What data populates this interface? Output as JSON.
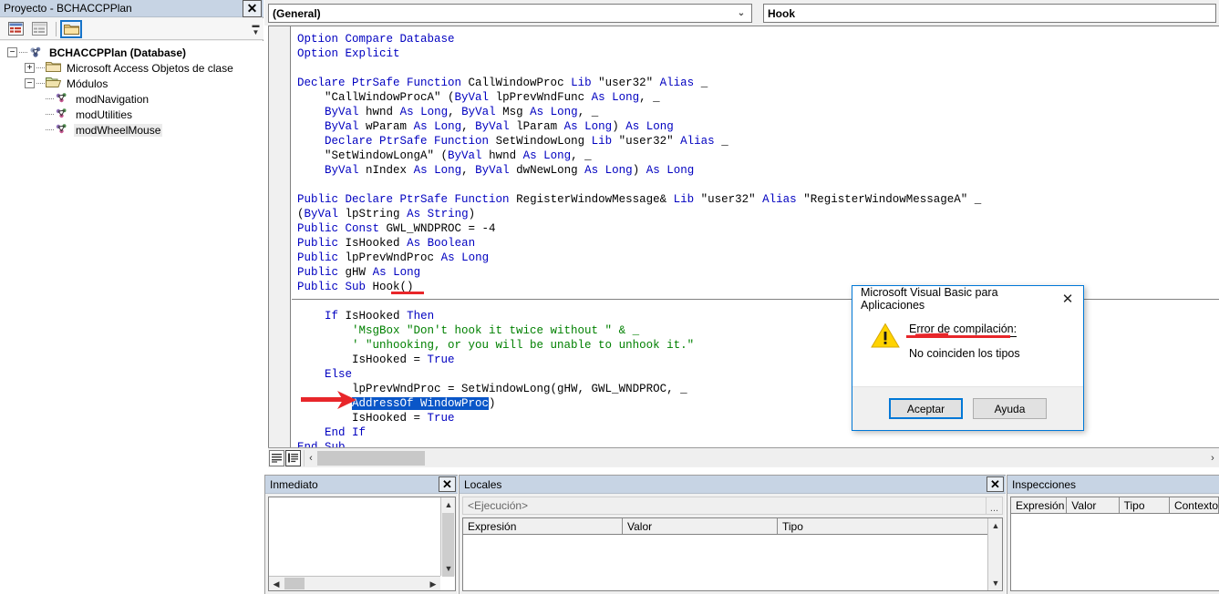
{
  "project_explorer": {
    "title": "Proyecto - BCHACCPPlan",
    "close_label": "✕",
    "toolbar": [
      {
        "name": "view-code-button",
        "label": ""
      },
      {
        "name": "view-object-button",
        "label": ""
      },
      {
        "name": "toggle-folders-button",
        "label": ""
      }
    ],
    "tree": [
      {
        "label": "BCHACCPPlan (Database)",
        "icon": "database-icon",
        "depth": 0,
        "expander": "−",
        "bold": true,
        "selected": false
      },
      {
        "label": "Microsoft Access Objetos de clase",
        "icon": "folder-icon",
        "depth": 1,
        "expander": "+",
        "bold": false,
        "selected": false
      },
      {
        "label": "Módulos",
        "icon": "folder-open-icon",
        "depth": 1,
        "expander": "−",
        "bold": false,
        "selected": false
      },
      {
        "label": "modNavigation",
        "icon": "module-icon",
        "depth": 2,
        "expander": "",
        "bold": false,
        "selected": false
      },
      {
        "label": "modUtilities",
        "icon": "module-icon",
        "depth": 2,
        "expander": "",
        "bold": false,
        "selected": false
      },
      {
        "label": "modWheelMouse",
        "icon": "module-icon",
        "depth": 2,
        "expander": "",
        "bold": false,
        "selected": true
      }
    ]
  },
  "code_editor": {
    "object_combo": {
      "value": "(General)",
      "chevron": "⌄"
    },
    "proc_combo": {
      "value": "Hook",
      "chevron": ""
    },
    "horizontal_scroll": {
      "left_arrow": "‹",
      "right_arrow": "›"
    },
    "lines": [
      {
        "text": "Option Compare Database"
      },
      {
        "text": "Option Explicit"
      },
      {
        "text": ""
      },
      {
        "text": "Declare PtrSafe Function CallWindowProc Lib \"user32\" Alias _"
      },
      {
        "text": "    \"CallWindowProcA\" (ByVal lpPrevWndFunc As Long, _"
      },
      {
        "text": "    ByVal hwnd As Long, ByVal Msg As Long, _"
      },
      {
        "text": "    ByVal wParam As Long, ByVal lParam As Long) As Long"
      },
      {
        "text": "    Declare PtrSafe Function SetWindowLong Lib \"user32\" Alias _"
      },
      {
        "text": "    \"SetWindowLongA\" (ByVal hwnd As Long, _"
      },
      {
        "text": "    ByVal nIndex As Long, ByVal dwNewLong As Long) As Long"
      },
      {
        "text": ""
      },
      {
        "text": "Public Declare PtrSafe Function RegisterWindowMessage& Lib \"user32\" Alias \"RegisterWindowMessageA\" _"
      },
      {
        "text": "(ByVal lpString As String)"
      },
      {
        "text": "Public Const GWL_WNDPROC = -4"
      },
      {
        "text": "Public IsHooked As Boolean"
      },
      {
        "text": "Public lpPrevWndProc As Long"
      },
      {
        "text": "Public gHW As Long"
      },
      {
        "text": "Public Sub Hook()"
      },
      {
        "text": ""
      },
      {
        "text": "    If IsHooked Then"
      },
      {
        "text": "        'MsgBox \"Don't hook it twice without \" & _"
      },
      {
        "text": "        ' \"unhooking, or you will be unable to unhook it.\""
      },
      {
        "text": "        IsHooked = True"
      },
      {
        "text": "    Else"
      },
      {
        "text": "        lpPrevWndProc = SetWindowLong(gHW, GWL_WNDPROC, _"
      },
      {
        "text": "        AddressOf WindowProc)"
      },
      {
        "text": "        IsHooked = True"
      },
      {
        "text": "    End If"
      },
      {
        "text": "End Sub"
      }
    ],
    "highlighted_selection": "AddressOf WindowProc"
  },
  "inmediato": {
    "title": "Inmediato",
    "close_label": "✕"
  },
  "locales": {
    "title": "Locales",
    "close_label": "✕",
    "context": "<Ejecución>",
    "context_button": "...",
    "columns": [
      "Expresión",
      "Valor",
      "Tipo"
    ],
    "rows": []
  },
  "inspecciones": {
    "title": "Inspecciones",
    "columns": [
      "Expresión",
      "Valor",
      "Tipo",
      "Contexto"
    ],
    "rows": []
  },
  "dialog": {
    "title": "Microsoft Visual Basic para Aplicaciones",
    "close_label": "✕",
    "icon": "warning-triangle-icon",
    "heading": "Error de compilación:",
    "message": "No coinciden los tipos",
    "buttons": [
      {
        "label": "Aceptar",
        "default": true
      },
      {
        "label": "Ayuda",
        "default": false
      }
    ]
  },
  "annotations": {
    "arrow_color": "#e8262a",
    "underline_color": "#e8262a"
  },
  "colors": {
    "keyword": "#0000c0",
    "comment": "#008000",
    "selection_bg": "#0a56c8",
    "panel_title_bg": "#c7d4e4",
    "dialog_border": "#0078d7"
  }
}
